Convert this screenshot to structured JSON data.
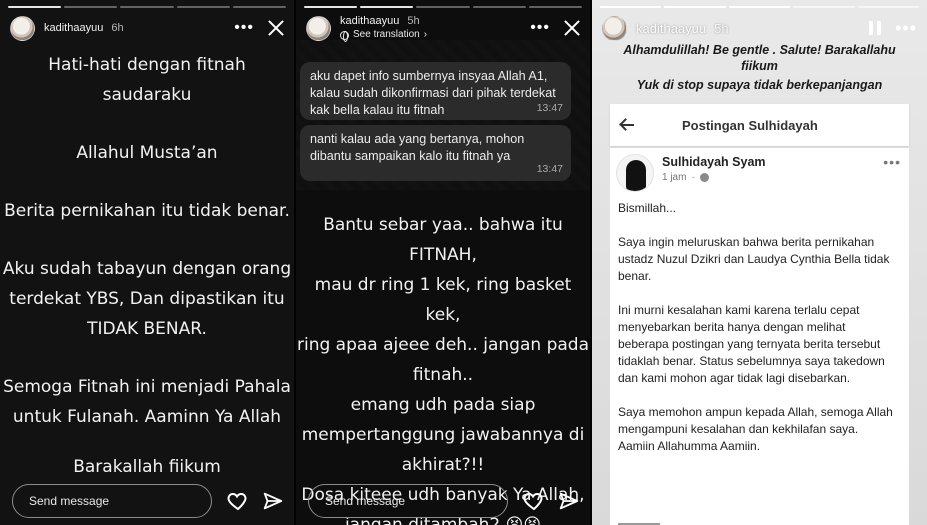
{
  "stories": [
    {
      "username": "kadithaayuu",
      "time": "6h",
      "progress_segments": 5,
      "progress_filled": 1,
      "lines": [
        [
          "Hati-hati dengan fitnah",
          "saudaraku"
        ],
        [
          "Allahul Musta’an"
        ],
        [
          "Berita pernikahan itu tidak benar."
        ],
        [
          "Aku sudah tabayun dengan orang",
          "terdekat YBS, Dan dipastikan itu",
          "TIDAK BENAR."
        ],
        [
          "Semoga Fitnah ini menjadi Pahala",
          "untuk Fulanah. Aaminn Ya Allah"
        ],
        [
          "Barakallah fiikum"
        ]
      ],
      "send_placeholder": "Send message"
    },
    {
      "username": "kadithaayuu",
      "time": "5h",
      "see_translation": "See translation",
      "progress_segments": 5,
      "progress_filled": 2,
      "chat": [
        {
          "text": "aku dapet info sumbernya insyaa Allah A1, kalau sudah dikonfirmasi dari pihak terdekat kak bella kalau itu fitnah",
          "time": "13:47"
        },
        {
          "text": "nanti kalau ada yang bertanya, mohon dibantu sampaikan kalo itu fitnah ya",
          "time": "13:47"
        }
      ],
      "lines": [
        "Bantu sebar yaa.. bahwa itu FITNAH,",
        "mau dr ring 1 kek, ring basket kek,",
        "ring apaa ajeee deh.. jangan pada",
        "fitnah..",
        "emang udh pada siap",
        "mempertanggung jawabannya di",
        "akhirat?!!",
        "Dosa kiteee udh banyak Ya Allah,",
        "jangan ditambah2 😫😫"
      ],
      "send_placeholder": "Send message"
    },
    {
      "username": "kadithaayuu",
      "time": "5h",
      "progress_segments": 5,
      "progress_filled": 3,
      "caption": [
        "Alhamdulillah! Be gentle . Salute! Barakallahu",
        "fiikum",
        "Yuk di stop supaya tidak berkepanjangan"
      ],
      "fb_title": "Postingan Sulhidayah",
      "post_author": "Sulhidayah Syam",
      "post_time": "1 jam",
      "post_paragraphs": [
        "Bismillah...",
        "Saya ingin meluruskan bahwa berita pernikahan ustadz Nuzul Dzikri dan Laudya Cynthia Bella tidak benar.",
        "Ini murni kesalahan kami karena terlalu cepat menyebarkan berita hanya dengan melihat beberapa postingan yang ternyata berita tersebut tidaklah benar. Status sebelumnya saya takedown dan kami mohon agar tidak lagi disebarkan.",
        "Saya memohon ampun kepada Allah, semoga Allah mengampuni kesalahan dan kekhilafan saya.",
        "Aamiin Allahumma Aamiin."
      ]
    }
  ],
  "icons": {
    "avatar": "profile-avatar",
    "more": "more-dots-icon",
    "close": "close-icon",
    "pause": "pause-icon",
    "heart": "heart-icon",
    "send": "send-icon",
    "back": "back-arrow-icon",
    "globe": "globe-icon"
  },
  "colors": {
    "story_bg_1": "#121212",
    "story_bg_2": "#0d0d0d",
    "bubble": "#2b2b2b",
    "caption_text": "#1a1a1a"
  }
}
